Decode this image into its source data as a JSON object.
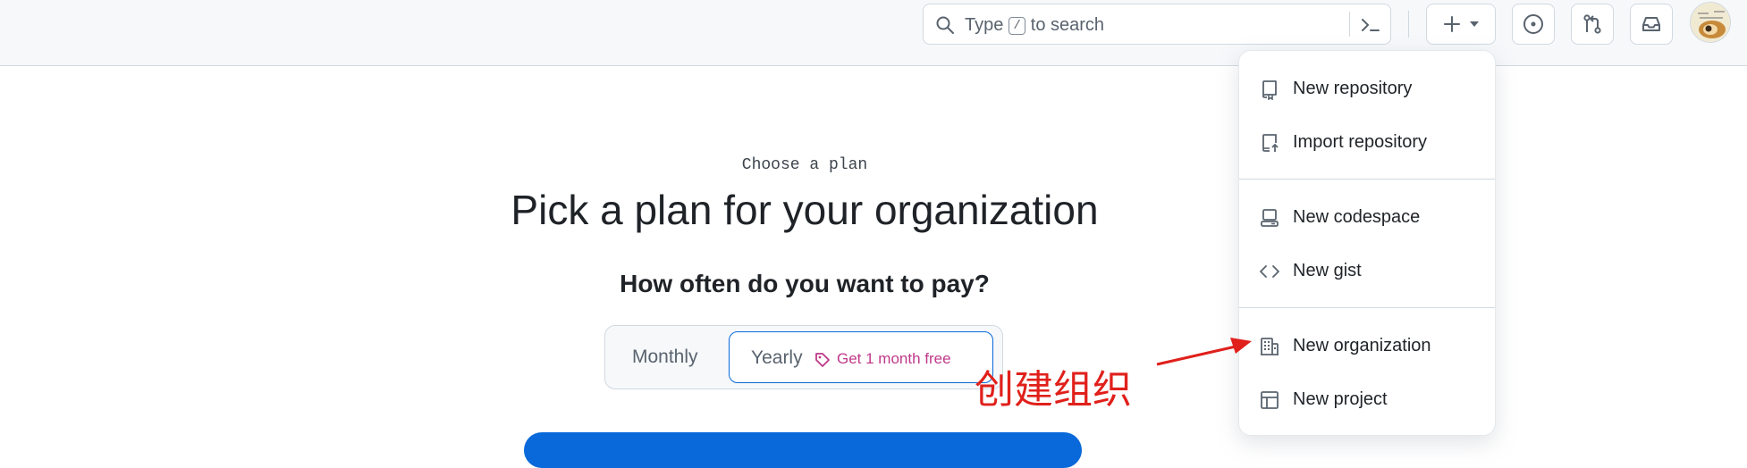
{
  "header": {
    "search": {
      "prefix": "Type",
      "key": "/",
      "suffix": "to search"
    },
    "icons": {
      "search": "search-icon",
      "command_palette": "terminal-icon",
      "create": "plus-icon",
      "create_caret": "triangle-down-icon",
      "issues": "issue-opened-icon",
      "pull_requests": "git-pull-request-icon",
      "inbox": "inbox-icon",
      "avatar": "user-avatar"
    }
  },
  "main": {
    "kicker": "Choose a plan",
    "title": "Pick a plan for your organization",
    "subtitle": "How often do you want to pay?",
    "billing_toggle": {
      "options": [
        "Monthly",
        "Yearly"
      ],
      "selected": "Yearly",
      "promo": "Get 1 month free"
    }
  },
  "create_menu": {
    "items": [
      {
        "label": "New repository",
        "icon": "repo-icon"
      },
      {
        "label": "Import repository",
        "icon": "repo-push-icon"
      },
      {
        "label": "New codespace",
        "icon": "codespaces-icon"
      },
      {
        "label": "New gist",
        "icon": "code-icon"
      },
      {
        "label": "New organization",
        "icon": "organization-icon"
      },
      {
        "label": "New project",
        "icon": "table-icon"
      }
    ]
  },
  "annotation": {
    "text": "创建组织",
    "color": "#e0201b"
  },
  "colors": {
    "accent": "#0969da",
    "promo": "#bf3989",
    "header_bg": "#f6f8fa",
    "text": "#1f2328",
    "muted": "#59636e"
  }
}
